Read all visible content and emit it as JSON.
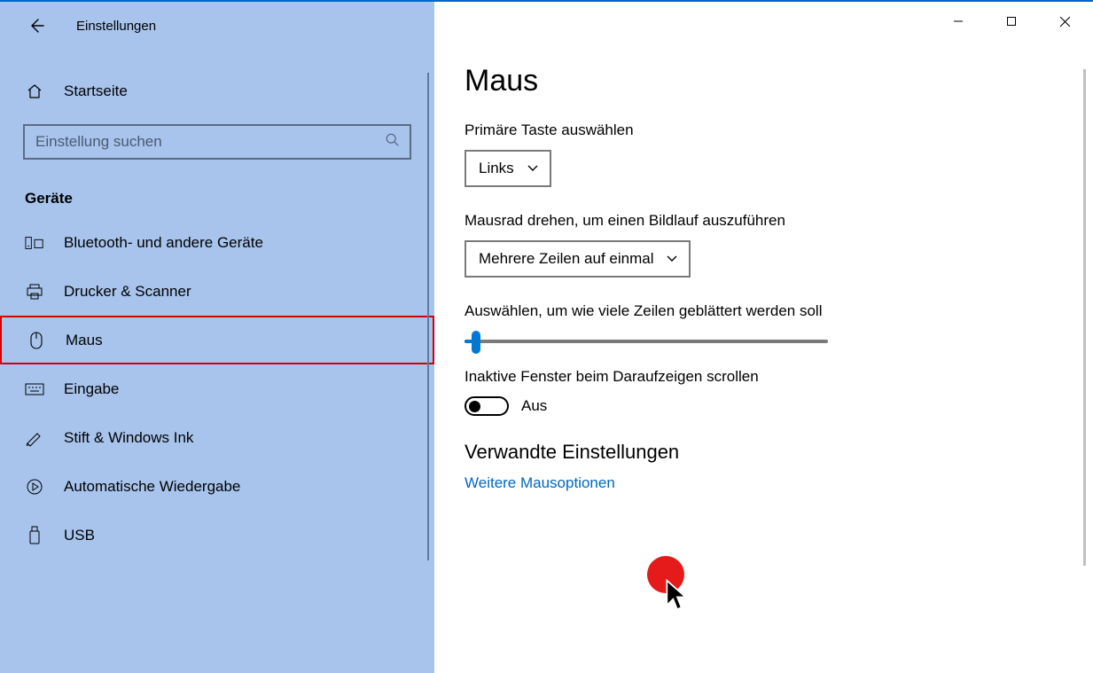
{
  "header": {
    "title": "Einstellungen"
  },
  "home": {
    "label": "Startseite"
  },
  "search": {
    "placeholder": "Einstellung suchen"
  },
  "category": "Geräte",
  "nav": [
    {
      "label": "Bluetooth- und andere Geräte",
      "icon": "bluetooth-devices-icon"
    },
    {
      "label": "Drucker & Scanner",
      "icon": "printer-icon"
    },
    {
      "label": "Maus",
      "icon": "mouse-icon",
      "selected": true
    },
    {
      "label": "Eingabe",
      "icon": "keyboard-icon"
    },
    {
      "label": "Stift & Windows Ink",
      "icon": "pen-icon"
    },
    {
      "label": "Automatische Wiedergabe",
      "icon": "autoplay-icon"
    },
    {
      "label": "USB",
      "icon": "usb-icon"
    }
  ],
  "page": {
    "title": "Maus",
    "primary": {
      "label": "Primäre Taste auswählen",
      "value": "Links"
    },
    "scrollwheel": {
      "label": "Mausrad drehen, um einen Bildlauf auszuführen",
      "value": "Mehrere Zeilen auf einmal"
    },
    "lines": {
      "label": "Auswählen, um wie viele Zeilen geblättert werden soll",
      "percent": 3
    },
    "inactive": {
      "label": "Inaktive Fenster beim Daraufzeigen scrollen",
      "value": "Aus"
    },
    "related": {
      "title": "Verwandte Einstellungen",
      "link": "Weitere Mausoptionen"
    }
  }
}
